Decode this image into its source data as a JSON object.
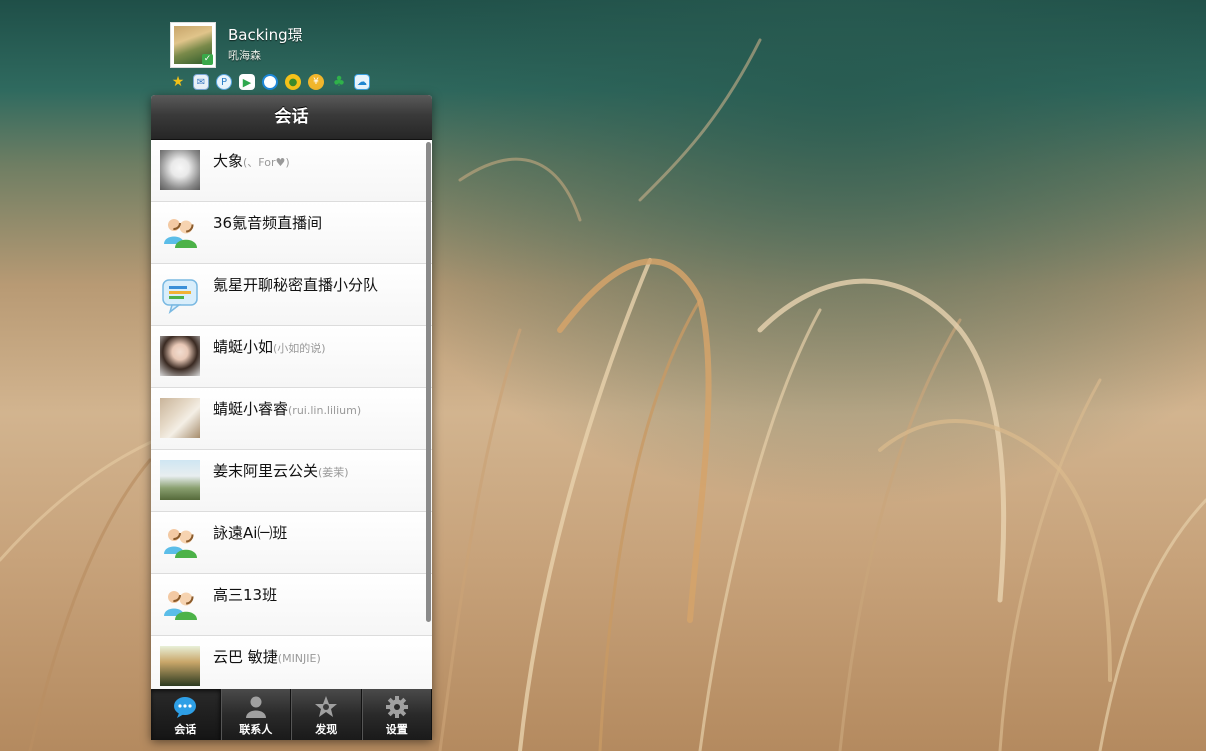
{
  "profile": {
    "nickname": "Backing璟",
    "signature": "吼海森"
  },
  "quick_icons": [
    "star-icon",
    "mail-icon",
    "search-icon",
    "play-icon",
    "browser-icon",
    "game-icon",
    "wallet-icon",
    "clover-icon",
    "cloud-icon"
  ],
  "panel": {
    "title": "会话"
  },
  "conversations": [
    {
      "name": "大象",
      "sub": "(、For♥)",
      "avatar": "photo"
    },
    {
      "name": "36氪音频直播间",
      "sub": "",
      "avatar": "group"
    },
    {
      "name": "氪星开聊秘密直播小分队",
      "sub": "",
      "avatar": "discussion"
    },
    {
      "name": "蜻蜓小如",
      "sub": "(小如的说)",
      "avatar": "photo"
    },
    {
      "name": "蜻蜓小睿睿",
      "sub": "(rui.lin.lilium)",
      "avatar": "photo"
    },
    {
      "name": "姜末阿里云公关",
      "sub": "(姜茉)",
      "avatar": "photo"
    },
    {
      "name": "詠遠Ai㈠班",
      "sub": "",
      "avatar": "group"
    },
    {
      "name": "高三13班",
      "sub": "",
      "avatar": "group"
    },
    {
      "name": "云巴 敏捷",
      "sub": "(MINJIE)",
      "avatar": "photo"
    }
  ],
  "tabs": [
    {
      "label": "会话",
      "icon": "chat-bubble-icon",
      "active": true
    },
    {
      "label": "联系人",
      "icon": "contacts-icon",
      "active": false
    },
    {
      "label": "发现",
      "icon": "discover-star-icon",
      "active": false
    },
    {
      "label": "设置",
      "icon": "gear-icon",
      "active": false
    }
  ],
  "colors": {
    "titlebar": "#3a3a3a",
    "tabbar": "#2a2a2a",
    "chat_icon_blue": "#2e9fe6",
    "group_icon_green": "#3aa84a"
  }
}
